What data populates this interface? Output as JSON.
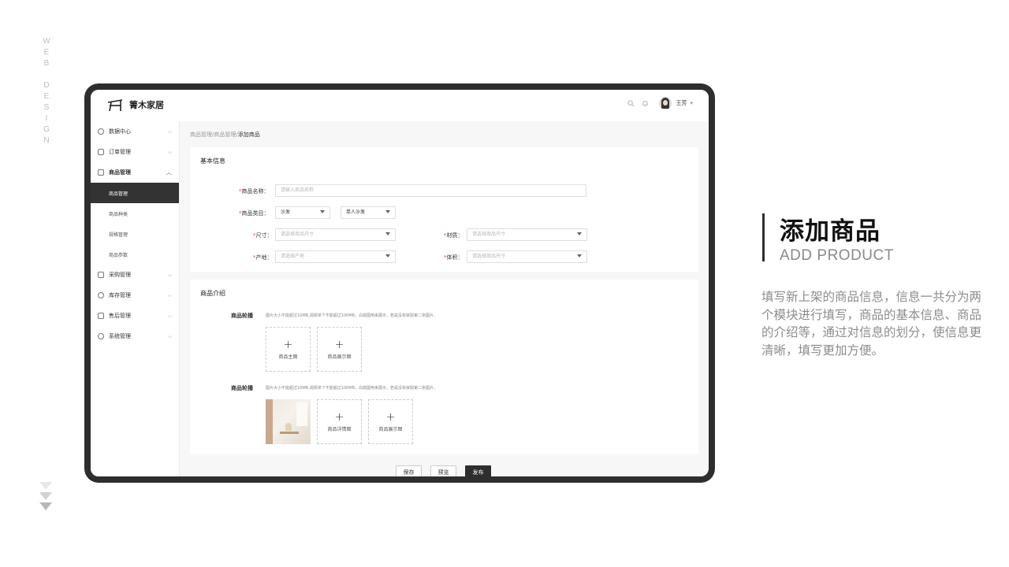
{
  "side_text": [
    "W",
    "E",
    "B",
    " ",
    "D",
    "E",
    "S",
    "I",
    "G",
    "N"
  ],
  "app": {
    "name": "箐木家居"
  },
  "topbar": {
    "search_icon": "search-icon",
    "bell_icon": "bell-icon",
    "user_name": "王芳",
    "caret": "▾"
  },
  "sidebar": {
    "items": [
      {
        "label": "数据中心",
        "icon": "clock-icon",
        "chevron": "⌵"
      },
      {
        "label": "订单管理",
        "icon": "doc-icon",
        "chevron": "⌵"
      },
      {
        "label": "商品管理",
        "icon": "box-icon",
        "chevron": "︿"
      },
      {
        "label": "采购管理",
        "icon": "cart-icon",
        "chevron": "⌵"
      },
      {
        "label": "库存管理",
        "icon": "stock-icon",
        "chevron": "⌵"
      },
      {
        "label": "售后管理",
        "icon": "service-icon",
        "chevron": "⌵"
      },
      {
        "label": "系统管理",
        "icon": "gear-icon",
        "chevron": "⌵"
      }
    ],
    "sub_items": [
      "商品管理",
      "商品种类",
      "规格管理",
      "商品参数"
    ]
  },
  "breadcrumb": {
    "part1": "商品管理",
    "sep1": "/",
    "part2": "商品管理",
    "sep2": "/",
    "current": "添加商品"
  },
  "basic_info": {
    "title": "基本信息",
    "name_label": "商品名称：",
    "name_placeholder": "请输入商品名称",
    "category_label": "商品类目：",
    "category_value1": "沙发",
    "category_value2": "单人沙发",
    "size_label": "尺寸：",
    "size_placeholder": "请选择商品尺寸",
    "material_label": "材质：",
    "material_placeholder": "请选择商品尺寸",
    "origin_label": "产地：",
    "origin_placeholder": "请选择产地",
    "volume_label": "体积：",
    "volume_placeholder": "请选择商品尺寸",
    "required_mark": "*"
  },
  "intro": {
    "title": "商品介绍",
    "row1_label": "商品轮播",
    "row1_hint": "图片大小不能超过10MB,视频单个不能超过100MB，白底图用来展示，若是没有就取第二张图片。",
    "row1_boxes": [
      "商品主图",
      "商品展示图"
    ],
    "row2_label": "商品轮播",
    "row2_hint": "图片大小不能超过10MB,视频单个不能超过100MB，白底图用来展示，若是没有就取第二张图片。",
    "row2_boxes": [
      "商品详情图",
      "商品展示图"
    ],
    "plus": "+"
  },
  "actions": {
    "save": "保存",
    "preview": "预览",
    "publish": "发布"
  },
  "right_panel": {
    "title": "添加商品",
    "subtitle": "ADD PRODUCT",
    "description": "填写新上架的商品信息，信息一共分为两个模块进行填写，商品的基本信息、商品的介绍等，通过对信息的划分，使信息更清晰，填写更加方便。"
  }
}
